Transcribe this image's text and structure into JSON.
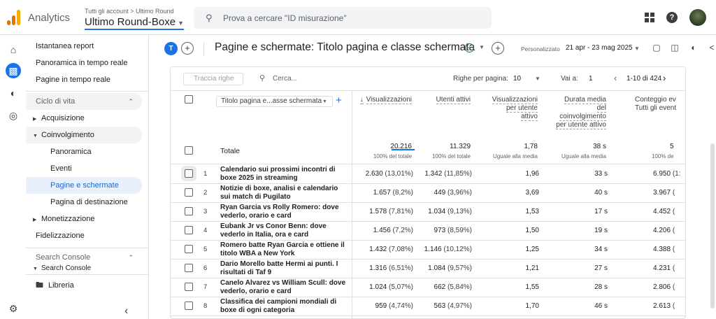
{
  "app": {
    "name": "Analytics",
    "account_path": "Tutti gli account > Ultimo Round",
    "property": "Ultimo Round-Boxe",
    "search_placeholder": "Prova a cercare \"ID misurazione\"",
    "logo_colors": [
      "#f9ab00",
      "#e37400",
      "#e37400"
    ]
  },
  "rail": [
    "home-icon",
    "reports-icon",
    "explore-icon",
    "advertising-icon",
    "settings-icon"
  ],
  "sidebar": {
    "top_items": [
      "Istantanea report",
      "Panoramica in tempo reale",
      "Pagine in tempo reale"
    ],
    "lifecycle_label": "Ciclo di vita",
    "acquisition": "Acquisizione",
    "engagement": "Coinvolgimento",
    "engagement_sub": [
      "Panoramica",
      "Eventi",
      "Pagine e schermate",
      "Pagina di destinazione"
    ],
    "monetization": "Monetizzazione",
    "retention": "Fidelizzazione",
    "search_console_label": "Search Console",
    "search_console_item": "Search Console",
    "library": "Libreria"
  },
  "header": {
    "chip": "T",
    "report_title": "Pagine e schermate: Titolo pagina e classe schermata",
    "date_label": "Personalizzato",
    "date_range": "21 apr - 23 mag 2025"
  },
  "table": {
    "track_placeholder": "Traccia righe",
    "search_placeholder": "Cerca...",
    "rows_per_page_label": "Righe per pagina:",
    "rows_per_page": "10",
    "goto_label": "Vai a:",
    "goto_value": "1",
    "pagination": "1-10 di 424",
    "dimension": "Titolo pagina e...asse schermata",
    "columns": [
      [
        "Visualizzazioni"
      ],
      [
        "Utenti attivi"
      ],
      [
        "Visualizzazioni",
        "per utente",
        "attivo"
      ],
      [
        "Durata media",
        "del",
        "coinvolgimento",
        "per utente attivo"
      ],
      [
        "Conteggio ev",
        "Tutti gli event"
      ]
    ],
    "totals_label": "Totale",
    "totals": [
      {
        "value": "20.216",
        "sub": "100% del totale"
      },
      {
        "value": "11.329",
        "sub": "100% del totale"
      },
      {
        "value": "1,78",
        "sub": "Uguale alla media"
      },
      {
        "value": "38 s",
        "sub": "Uguale alla media"
      },
      {
        "value": "5",
        "sub": "100% de"
      }
    ],
    "rows": [
      {
        "n": "1",
        "title": "Calendario sui prossimi incontri di boxe 2025 in streaming",
        "views": "2.630",
        "views_pct": "(13,01%)",
        "users": "1.342",
        "users_pct": "(11,85%)",
        "vpu": "1,96",
        "dur": "33 s",
        "events": "6.950",
        "events_pct": "(1:"
      },
      {
        "n": "2",
        "title": "Notizie di boxe, analisi e calendario sui match di Pugilato",
        "views": "1.657",
        "views_pct": "(8,2%)",
        "users": "449",
        "users_pct": "(3,96%)",
        "vpu": "3,69",
        "dur": "40 s",
        "events": "3.967",
        "events_pct": "("
      },
      {
        "n": "3",
        "title": "Ryan Garcia vs Rolly Romero: dove vederlo, orario e card",
        "views": "1.578",
        "views_pct": "(7,81%)",
        "users": "1.034",
        "users_pct": "(9,13%)",
        "vpu": "1,53",
        "dur": "17 s",
        "events": "4.452",
        "events_pct": "("
      },
      {
        "n": "4",
        "title": "Eubank Jr vs Conor Benn: dove vederlo in Italia, ora e card",
        "views": "1.456",
        "views_pct": "(7,2%)",
        "users": "973",
        "users_pct": "(8,59%)",
        "vpu": "1,50",
        "dur": "19 s",
        "events": "4.206",
        "events_pct": "("
      },
      {
        "n": "5",
        "title": "Romero batte Ryan Garcia e ottiene il titolo WBA a New York",
        "views": "1.432",
        "views_pct": "(7,08%)",
        "users": "1.146",
        "users_pct": "(10,12%)",
        "vpu": "1,25",
        "dur": "34 s",
        "events": "4.388",
        "events_pct": "("
      },
      {
        "n": "6",
        "title": "Dario Morello batte Hermi ai punti. I risultati di Taf 9",
        "views": "1.316",
        "views_pct": "(6,51%)",
        "users": "1.084",
        "users_pct": "(9,57%)",
        "vpu": "1,21",
        "dur": "27 s",
        "events": "4.231",
        "events_pct": "("
      },
      {
        "n": "7",
        "title": "Canelo Alvarez vs William Scull: dove vederlo, orario e card",
        "views": "1.024",
        "views_pct": "(5,07%)",
        "users": "662",
        "users_pct": "(5,84%)",
        "vpu": "1,55",
        "dur": "28 s",
        "events": "2.806",
        "events_pct": "("
      },
      {
        "n": "8",
        "title": "Classifica dei campioni mondiali di boxe di ogni categoria",
        "views": "959",
        "views_pct": "(4,74%)",
        "users": "563",
        "users_pct": "(4,97%)",
        "vpu": "1,70",
        "dur": "46 s",
        "events": "2.613",
        "events_pct": "("
      }
    ]
  }
}
